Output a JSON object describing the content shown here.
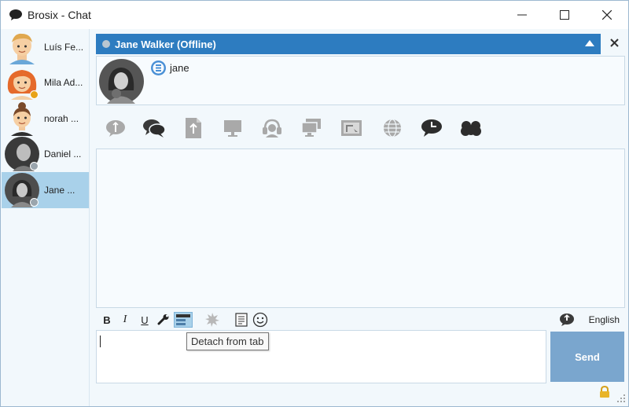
{
  "window": {
    "title": "Brosix - Chat"
  },
  "contacts": [
    {
      "name": "Luís Fe...",
      "status": "none"
    },
    {
      "name": "Mila Ad...",
      "status": "away"
    },
    {
      "name": "norah ...",
      "status": "none"
    },
    {
      "name": "Daniel ...",
      "status": "offline"
    },
    {
      "name": "Jane ...",
      "status": "offline"
    }
  ],
  "chat": {
    "header_name": "Jane Walker (Offline)",
    "username": "jane"
  },
  "toolbar_icons": [
    "contact-info-icon",
    "chat-bubbles-icon",
    "file-transfer-icon",
    "screen-share-icon",
    "voice-call-icon",
    "remote-desktop-icon",
    "screenshot-icon",
    "web-icon",
    "history-icon",
    "group-icon"
  ],
  "format": {
    "bold": "B",
    "italic": "I",
    "underline": "U",
    "language": "English"
  },
  "tooltip": "Detach from tab",
  "send_label": "Send",
  "colors": {
    "accent": "#2d7cc0",
    "selection": "#a9d1ea",
    "send": "#7aa6ce",
    "away": "#e8a317",
    "offline": "#9aa5ad"
  }
}
